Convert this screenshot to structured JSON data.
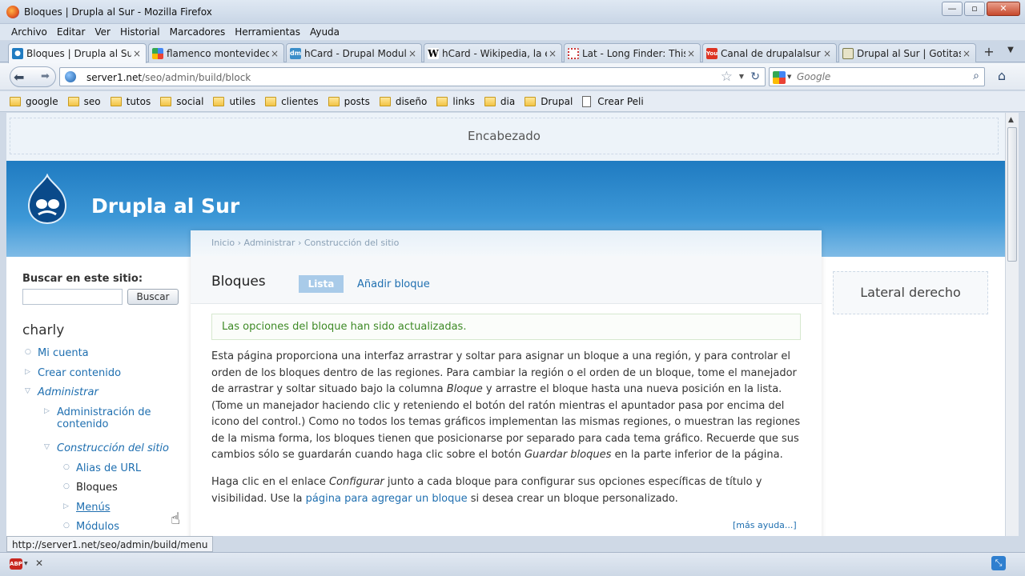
{
  "window": {
    "title": "Bloques | Drupla al Sur - Mozilla Firefox"
  },
  "menubar": [
    "Archivo",
    "Editar",
    "Ver",
    "Historial",
    "Marcadores",
    "Herramientas",
    "Ayuda"
  ],
  "tabs": [
    {
      "label": "Bloques | Drupla al Sur",
      "icon": "drupal-favicon",
      "active": true
    },
    {
      "label": "flamenco montevideo ...",
      "icon": "google-favicon"
    },
    {
      "label": "hCard - Drupal Modul...",
      "icon": "dm-favicon"
    },
    {
      "label": "hCard - Wikipedia, la e...",
      "icon": "wikipedia-favicon"
    },
    {
      "label": "Lat - Long Finder: This...",
      "icon": "latlong-favicon"
    },
    {
      "label": "Canal de drupalalsur - ...",
      "icon": "youtube-favicon"
    },
    {
      "label": "Drupal al Sur | Gotitas ...",
      "icon": "drupal-favicon"
    }
  ],
  "navbar": {
    "url_host": "server1.net",
    "url_path": "/seo/admin/build/block",
    "search_placeholder": "Google"
  },
  "bookmarks": [
    "google",
    "seo",
    "tutos",
    "social",
    "utiles",
    "clientes",
    "posts",
    "diseño",
    "links",
    "dia",
    "Drupal",
    "Crear Peli"
  ],
  "page": {
    "header_region": "Encabezado",
    "site_name": "Drupla al Sur",
    "search_label": "Buscar en este sitio:",
    "search_button": "Buscar",
    "username": "charly",
    "nav": {
      "mi_cuenta": "Mi cuenta",
      "crear": "Crear contenido",
      "administrar": "Administrar",
      "admin_contenido_1": "Administración de",
      "admin_contenido_2": "contenido",
      "construccion": "Construcción del sitio",
      "alias": "Alias de URL",
      "bloques": "Bloques",
      "menus": "Menús",
      "modulos": "Módulos"
    },
    "breadcrumb": "Inicio › Administrar › Construcción del sitio",
    "title": "Bloques",
    "tab_list": "Lista",
    "tab_add": "Añadir bloque",
    "status_message": "Las opciones del bloque han sido actualizadas.",
    "help": {
      "p1_a": "Esta página proporciona una interfaz arrastrar y soltar para asignar un bloque a una región, y para controlar el orden de los bloques dentro de las regiones. Para cambiar la región o el orden de un bloque, tome el manejador de arrastrar y soltar situado bajo la columna ",
      "p1_em1": "Bloque",
      "p1_b": " y arrastre el bloque hasta una nueva posición en la lista. (Tome un manejador haciendo clic y reteniendo el botón del ratón mientras el apuntador pasa por encima del icono del control.) Como no todos los temas gráficos implementan las mismas regiones, o muestran las regiones de la misma forma, los bloques tienen que posicionarse por separado para cada tema gráfico. Recuerde que sus cambios sólo se guardarán cuando haga clic sobre el botón ",
      "p1_em2": "Guardar bloques",
      "p1_c": " en la parte inferior de la página.",
      "p2_a": "Haga clic en el enlace ",
      "p2_em": "Configurar",
      "p2_b": " junto a cada bloque para configurar sus opciones específicas de título y visibilidad. Use la ",
      "p2_link": "página para agregar un bloque",
      "p2_c": " si desea crear un bloque personalizado.",
      "more": "[más ayuda...]"
    },
    "right_region": "Lateral derecho"
  },
  "statusbar": {
    "hover_url": "http://server1.net/seo/admin/build/menu",
    "abp": "ABP"
  },
  "colors": {
    "brand_blue": "#2b87cc",
    "link": "#1f6fb0",
    "status_green": "#3e8a26"
  }
}
